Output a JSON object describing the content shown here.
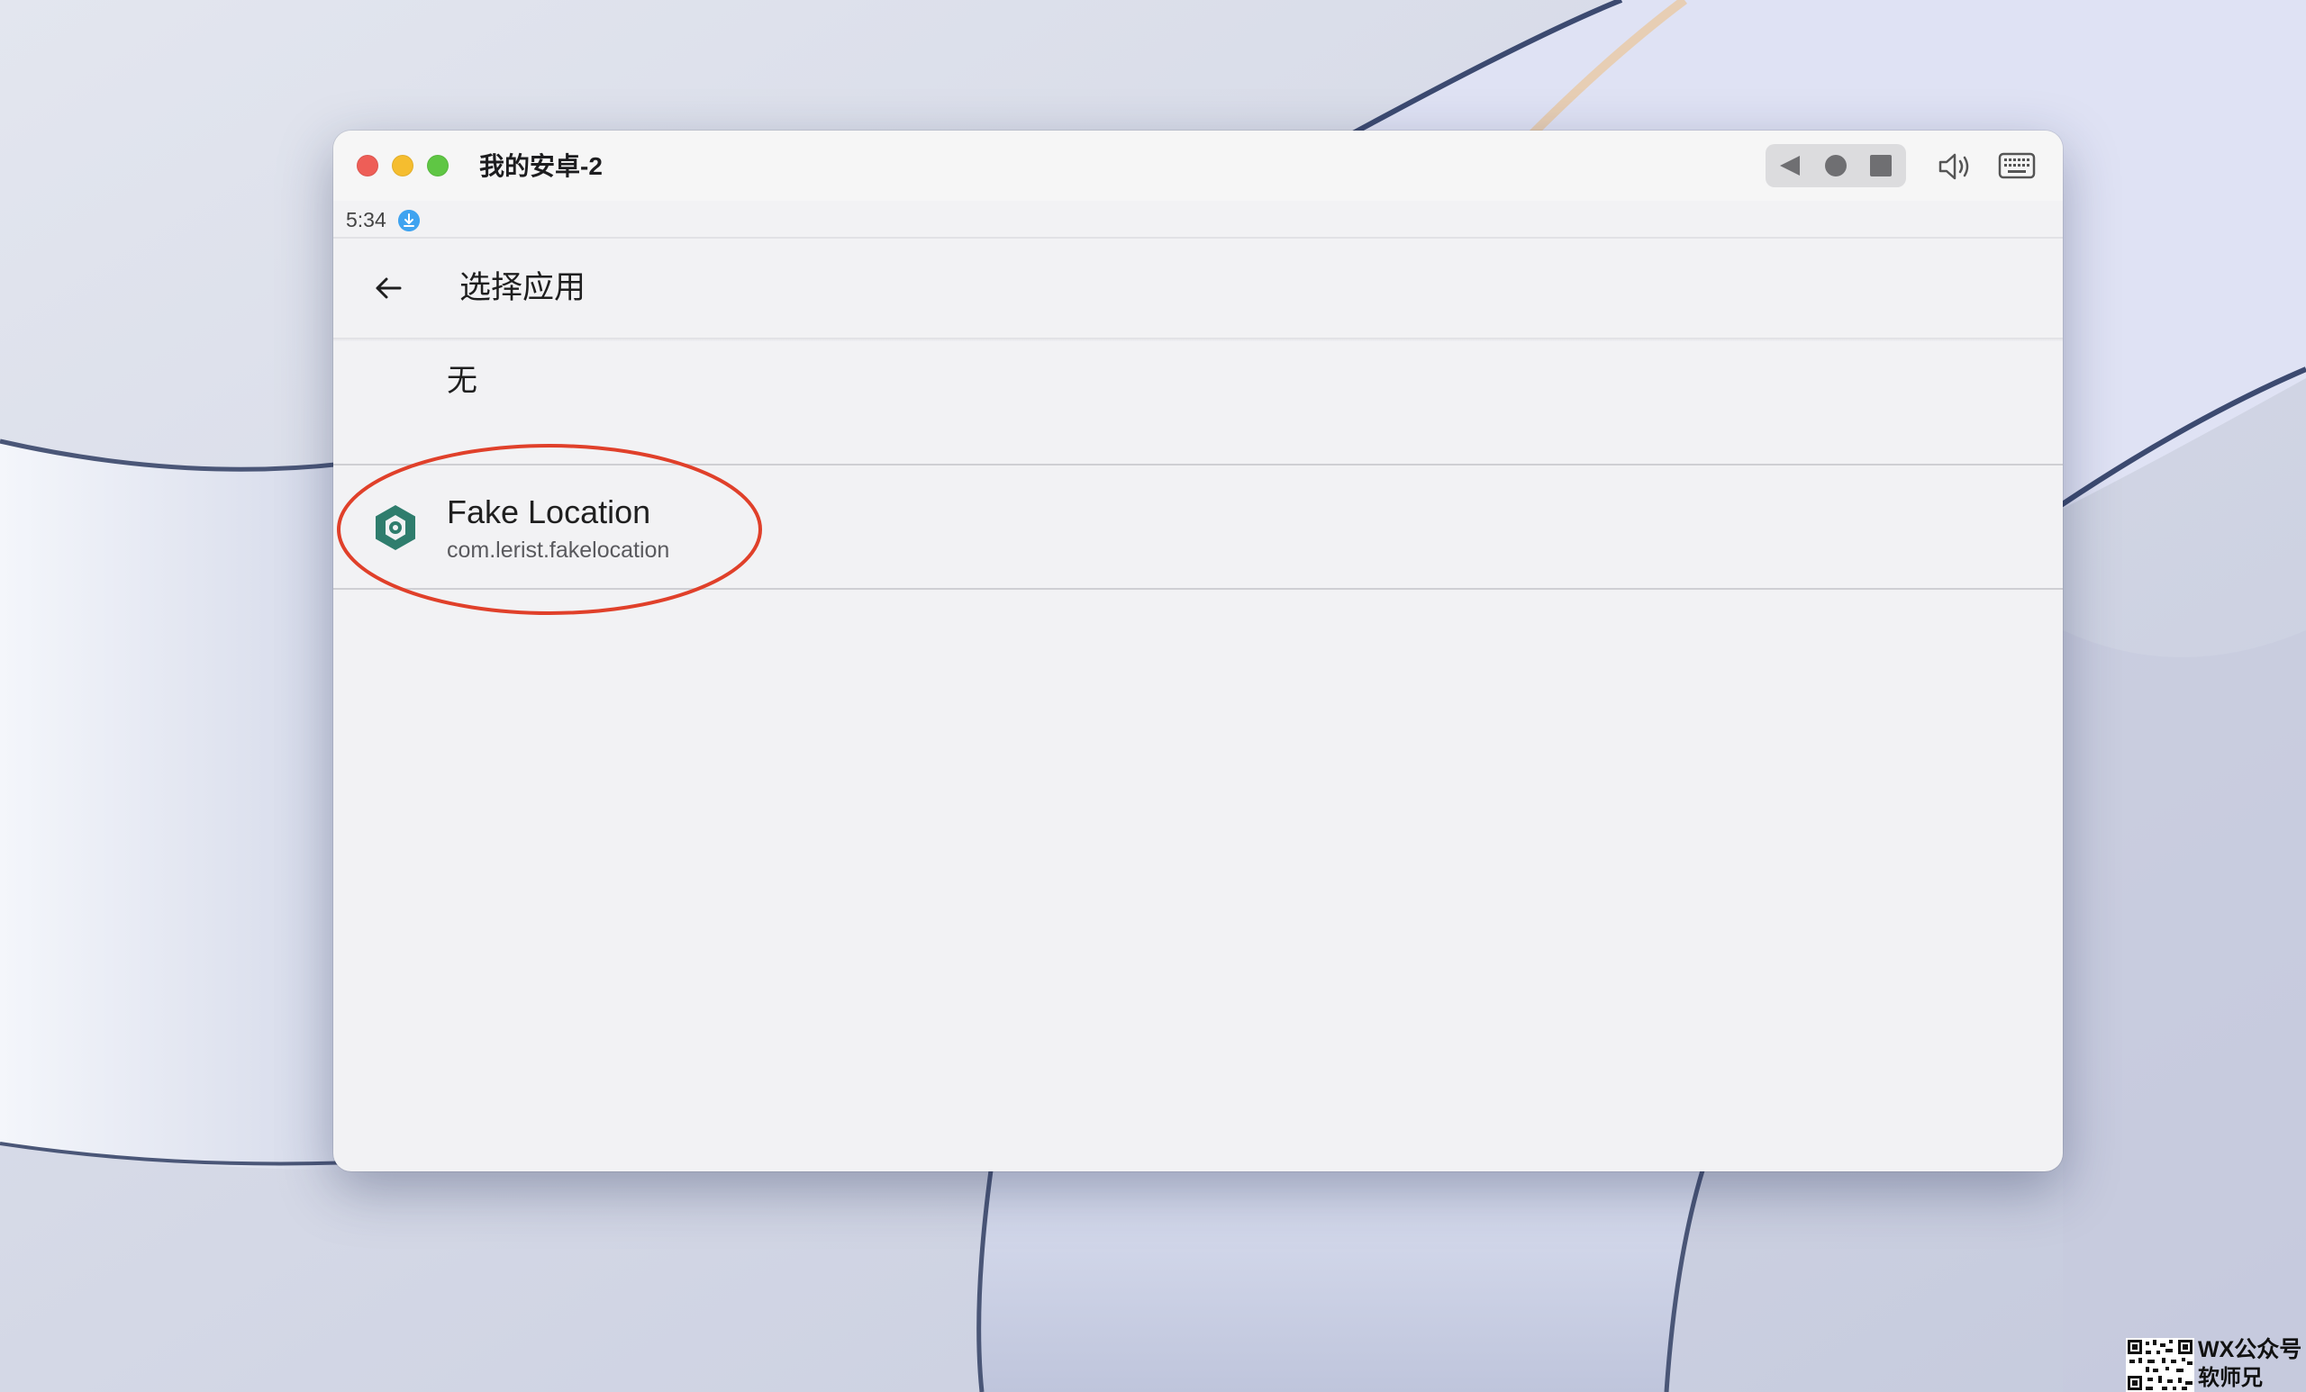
{
  "window": {
    "title": "我的安卓-2",
    "nav_buttons": [
      "back-triangle-icon",
      "home-circle-icon",
      "recents-square-icon"
    ],
    "tools": [
      "speaker-icon",
      "keyboard-icon"
    ]
  },
  "status_bar": {
    "time": "5:34",
    "notification_icon": "download-icon",
    "notification_color": "#3fa3f0"
  },
  "app_bar": {
    "back_icon": "arrow-back-icon",
    "title": "选择应用"
  },
  "app_list": {
    "items": [
      {
        "label": "无"
      },
      {
        "label": "Fake Location",
        "package": "com.lerist.fakelocation",
        "icon": "hexagon-app-icon",
        "icon_color": "#2f7d6d",
        "highlighted": true
      }
    ]
  },
  "annotation": {
    "shape": "ellipse",
    "color": "#e0402a"
  },
  "watermark": {
    "line1": "WX公众号",
    "line2": "软师兄"
  }
}
